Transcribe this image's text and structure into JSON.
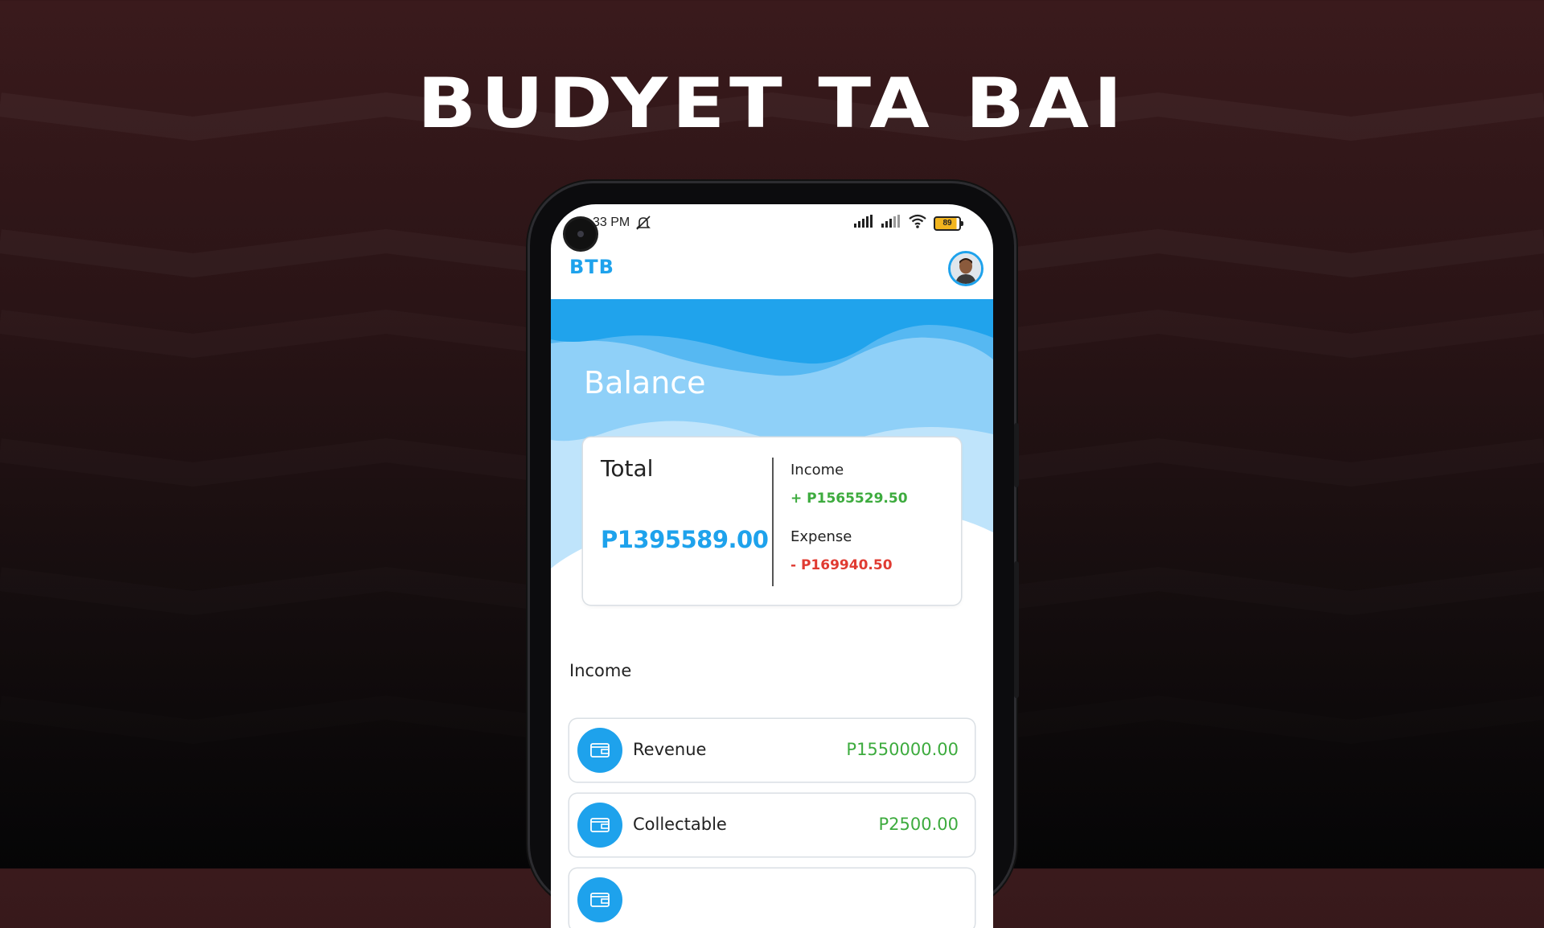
{
  "page": {
    "title": "BUDYET TA BAI"
  },
  "status_bar": {
    "time": "33 PM",
    "battery": "89"
  },
  "app_bar": {
    "brand": "BTB"
  },
  "balance": {
    "title": "Balance",
    "total_label": "Total",
    "total_value": "P1395589.00",
    "income_label": "Income",
    "income_value": "+ P1565529.50",
    "expense_label": "Expense",
    "expense_value": "- P169940.50"
  },
  "income_section": {
    "title": "Income",
    "items": [
      {
        "name": "Revenue",
        "amount": "P1550000.00"
      },
      {
        "name": "Collectable",
        "amount": "P2500.00"
      },
      {
        "name": "",
        "amount": ""
      }
    ]
  },
  "colors": {
    "accent": "#1ea2ec",
    "income": "#3dab3e",
    "expense": "#e03b32",
    "background": "#2a1416"
  },
  "icons": {
    "list_item": "wallet-icon",
    "status": [
      "mute-icon",
      "signal-icon",
      "wifi-icon",
      "battery-icon"
    ]
  }
}
